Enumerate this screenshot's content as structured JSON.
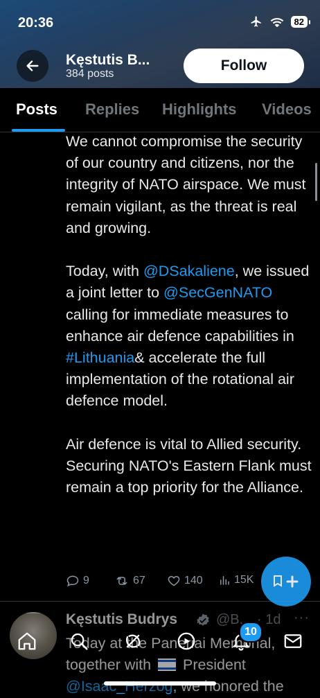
{
  "status_bar": {
    "time": "20:36",
    "battery": "82"
  },
  "profile_header": {
    "name": "Kęstutis B...",
    "posts_count": "384 posts",
    "follow_label": "Follow"
  },
  "tabs": [
    {
      "label": "Posts",
      "active": true
    },
    {
      "label": "Replies",
      "active": false
    },
    {
      "label": "Highlights",
      "active": false
    },
    {
      "label": "Videos",
      "active": false
    }
  ],
  "tweet": {
    "para1": "We cannot compromise the security of our country and citizens, nor the integrity of NATO airspace. We must remain vigilant, as the threat is real and growing.",
    "para2_a": "Today, with ",
    "para2_link1": "@DSakaliene",
    "para2_b": ", we issued a joint letter to ",
    "para2_link2": "@SecGenNATO",
    "para2_c": " calling for immediate measures to enhance air defence capabilities in ",
    "para2_link3": "#Lithuania",
    "para2_d": "& accelerate the full implementation of the rotational air defence model.",
    "para3": "Air defence is vital to Allied security. Securing NATO's Eastern Flank must remain a top priority for the Alliance.",
    "replies": "9",
    "reposts": "67",
    "likes": "140",
    "views": "15K"
  },
  "next_tweet": {
    "name": "Kęstutis Budrys",
    "handle": "@B...",
    "time": "· 1d",
    "more": "···",
    "text_a": "Today at the Paneriai Memorial, together with ",
    "text_b": " President ",
    "text_link": "@Isaac_Herzog",
    "text_c": ", we honored the"
  },
  "bottom_nav": {
    "notifications_badge": "10"
  },
  "colors": {
    "accent": "#1d9bf0",
    "background": "#000000",
    "text": "#e7e9ea",
    "muted": "#71767b"
  }
}
